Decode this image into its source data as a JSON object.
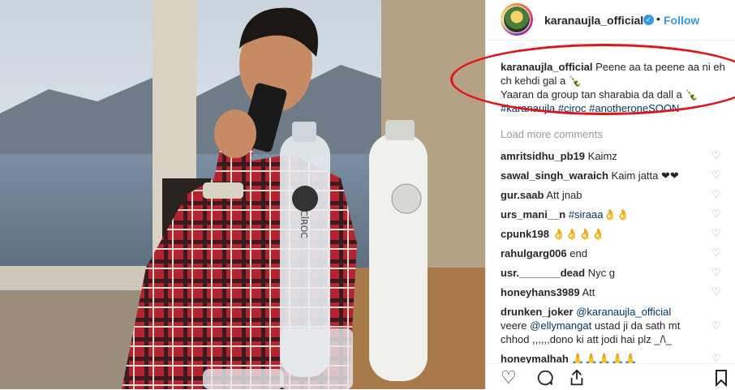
{
  "post": {
    "username": "karanaujla_official",
    "follow_label": "Follow",
    "dot": "•",
    "caption_user": "karanaujla_official",
    "caption_line1": "Peene aa ta peene aa ni eh ch kehdi gal a 🍾",
    "caption_line2": "Yaaran da group tan sharabia da dall a 🍾",
    "caption_tags": "#karanaujla #ciroc #anotheroneSOON",
    "load_more": "Load more comments"
  },
  "comments": [
    {
      "user": "amritsidhu_pb19",
      "text": "Kaimz"
    },
    {
      "user": "sawal_singh_waraich",
      "text": "Kaim jatta ❤❤"
    },
    {
      "user": "gur.saab",
      "text": "Att jnab"
    },
    {
      "user": "urs_mani__n",
      "text": "#siraaa👌👌"
    },
    {
      "user": "cpunk198",
      "text": "👌👌👌👌"
    },
    {
      "user": "rahulgarg006",
      "text": "end"
    },
    {
      "user": "usr._______dead",
      "text": "Nyc g"
    },
    {
      "user": "honeyhans3989",
      "text": "Att"
    },
    {
      "user": "drunken_joker",
      "mention": "@karanaujla_official",
      "text_line2_prefix": "veere ",
      "mention2": "@ellymangat",
      "text_line2": " ustad ji da sath mt",
      "text_line3": "chhod ,,,,,,dono ki att jodi hai plz _/\\_"
    },
    {
      "user": "honeymalhah",
      "text": "🙏🙏🙏🙏🙏"
    }
  ],
  "photo": {
    "bottle_brand": "CÎROC"
  },
  "colors": {
    "accent": "#3897f0",
    "annotation": "#e0161a"
  },
  "icons": [
    "heart-icon",
    "comment-icon",
    "share-icon",
    "bookmark-icon",
    "verified-icon"
  ]
}
